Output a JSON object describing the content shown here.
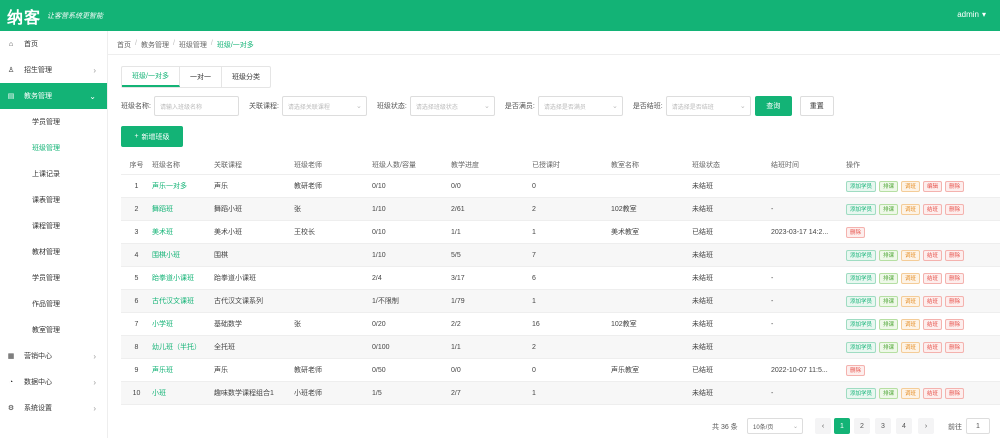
{
  "header": {
    "logo": "纳客",
    "slogan": "让客营系统更智能",
    "user": "admin",
    "user_caret": "▾"
  },
  "sidebar": {
    "items": [
      {
        "label": "首页",
        "icon": "home-icon",
        "glyph": "⌂",
        "arrow": ""
      },
      {
        "label": "招生管理",
        "icon": "enroll-icon",
        "glyph": "♙",
        "arrow": "›"
      },
      {
        "label": "教务管理",
        "icon": "academic-icon",
        "glyph": "▤",
        "arrow": "⌄",
        "active": true
      }
    ],
    "sub_items": [
      "学员管理",
      "班级管理",
      "上课记录",
      "课表管理",
      "课程管理",
      "教材管理",
      "学员管理",
      "作品管理",
      "教室管理"
    ],
    "current_sub": 1,
    "bottom_items": [
      {
        "label": "营销中心",
        "icon": "marketing-icon",
        "glyph": "▦",
        "arrow": "›"
      },
      {
        "label": "数据中心",
        "icon": "data-icon",
        "glyph": "◔",
        "arrow": "›"
      },
      {
        "label": "系统设置",
        "icon": "settings-icon",
        "glyph": "⚙",
        "arrow": "›"
      }
    ]
  },
  "breadcrumb": [
    "首页",
    "教务管理",
    "班级管理",
    "班级/一对多"
  ],
  "tabs": [
    "班级/一对多",
    "一对一",
    "班级分类"
  ],
  "filters": {
    "name_label": "班级名称:",
    "name_placeholder": "请输入班级名称",
    "course_label": "关联课程:",
    "course_placeholder": "请选择关联课程",
    "status_label": "班级状态:",
    "status_placeholder": "请选择班级状态",
    "full_label": "是否满员:",
    "full_placeholder": "请选择是否满员",
    "end_label": "是否结班:",
    "end_placeholder": "请选择是否结班",
    "search_label": "查询",
    "reset_label": "重置"
  },
  "add_button": "新增班级",
  "table": {
    "columns": [
      "序号",
      "班级名称",
      "关联课程",
      "班级老师",
      "班级人数/容量",
      "教学进度",
      "已授课时",
      "教室名称",
      "班级状态",
      "结班时间",
      "操作"
    ],
    "rows": [
      {
        "idx": "1",
        "name": "声乐一对多",
        "course": "声乐",
        "teacher": "教研老师",
        "capacity": "0/10",
        "progress": "0/0",
        "done": "0",
        "room": "",
        "status": "未结班",
        "end": "",
        "ops": [
          "添加学员",
          "排课",
          "调班",
          "编辑",
          "删除"
        ]
      },
      {
        "idx": "2",
        "name": "舞蹈班",
        "course": "舞蹈小班",
        "teacher": "张",
        "capacity": "1/10",
        "progress": "2/61",
        "done": "2",
        "room": "102教室",
        "status": "未结班",
        "end": "-",
        "ops": [
          "添加学员",
          "排课",
          "调班",
          "结班",
          "删除"
        ]
      },
      {
        "idx": "3",
        "name": "美术班",
        "course": "美术小班",
        "teacher": "王校长",
        "capacity": "0/10",
        "progress": "1/1",
        "done": "1",
        "room": "美术教室",
        "status": "已结班",
        "end": "2023-03-17 14:2...",
        "ops": [
          "删除"
        ]
      },
      {
        "idx": "4",
        "name": "围棋小班",
        "course": "围棋",
        "teacher": "",
        "capacity": "1/10",
        "progress": "5/5",
        "done": "7",
        "room": "",
        "status": "未结班",
        "end": "",
        "ops": [
          "添加学员",
          "排课",
          "调班",
          "结班",
          "删除"
        ]
      },
      {
        "idx": "5",
        "name": "跆拳道小课班",
        "course": "跆拳道小课班",
        "teacher": "",
        "capacity": "2/4",
        "progress": "3/17",
        "done": "6",
        "room": "",
        "status": "未结班",
        "end": "-",
        "ops": [
          "添加学员",
          "排课",
          "调班",
          "结班",
          "删除"
        ]
      },
      {
        "idx": "6",
        "name": "古代汉文课班",
        "course": "古代汉文课系列",
        "teacher": "",
        "capacity": "1/不限制",
        "progress": "1/79",
        "done": "1",
        "room": "",
        "status": "未结班",
        "end": "-",
        "ops": [
          "添加学员",
          "排课",
          "调班",
          "结班",
          "删除"
        ]
      },
      {
        "idx": "7",
        "name": "小学班",
        "course": "基础数学",
        "teacher": "张",
        "capacity": "0/20",
        "progress": "2/2",
        "done": "16",
        "room": "102教室",
        "status": "未结班",
        "end": "-",
        "ops": [
          "添加学员",
          "排课",
          "调班",
          "结班",
          "删除"
        ]
      },
      {
        "idx": "8",
        "name": "幼儿班（半托）",
        "course": "全托班",
        "teacher": "",
        "capacity": "0/100",
        "progress": "1/1",
        "done": "2",
        "room": "",
        "status": "未结班",
        "end": "",
        "ops": [
          "添加学员",
          "排课",
          "调班",
          "结班",
          "删除"
        ]
      },
      {
        "idx": "9",
        "name": "声乐班",
        "course": "声乐",
        "teacher": "教研老师",
        "capacity": "0/50",
        "progress": "0/0",
        "done": "0",
        "room": "声乐教室",
        "status": "已结班",
        "end": "2022-10-07 11:5...",
        "ops": [
          "删除"
        ]
      },
      {
        "idx": "10",
        "name": "小班",
        "course": "趣味数学课程组合1",
        "teacher": "小班老师",
        "capacity": "1/5",
        "progress": "2/7",
        "done": "1",
        "room": "",
        "status": "未结班",
        "end": "-",
        "ops": [
          "添加学员",
          "排课",
          "调班",
          "结班",
          "删除"
        ]
      }
    ]
  },
  "pagination": {
    "total": "共 36 条",
    "page_size": "10条/页",
    "prev": "‹",
    "pages": [
      "1",
      "2",
      "3",
      "4"
    ],
    "current": "1",
    "next": "›",
    "goto_label": "前往",
    "goto_value": "1"
  },
  "colors": {
    "brand": "#13b376",
    "op_green": "#13b376",
    "op_lime": "#52a73a",
    "op_orange": "#e6902a",
    "op_red": "#e6514a"
  }
}
